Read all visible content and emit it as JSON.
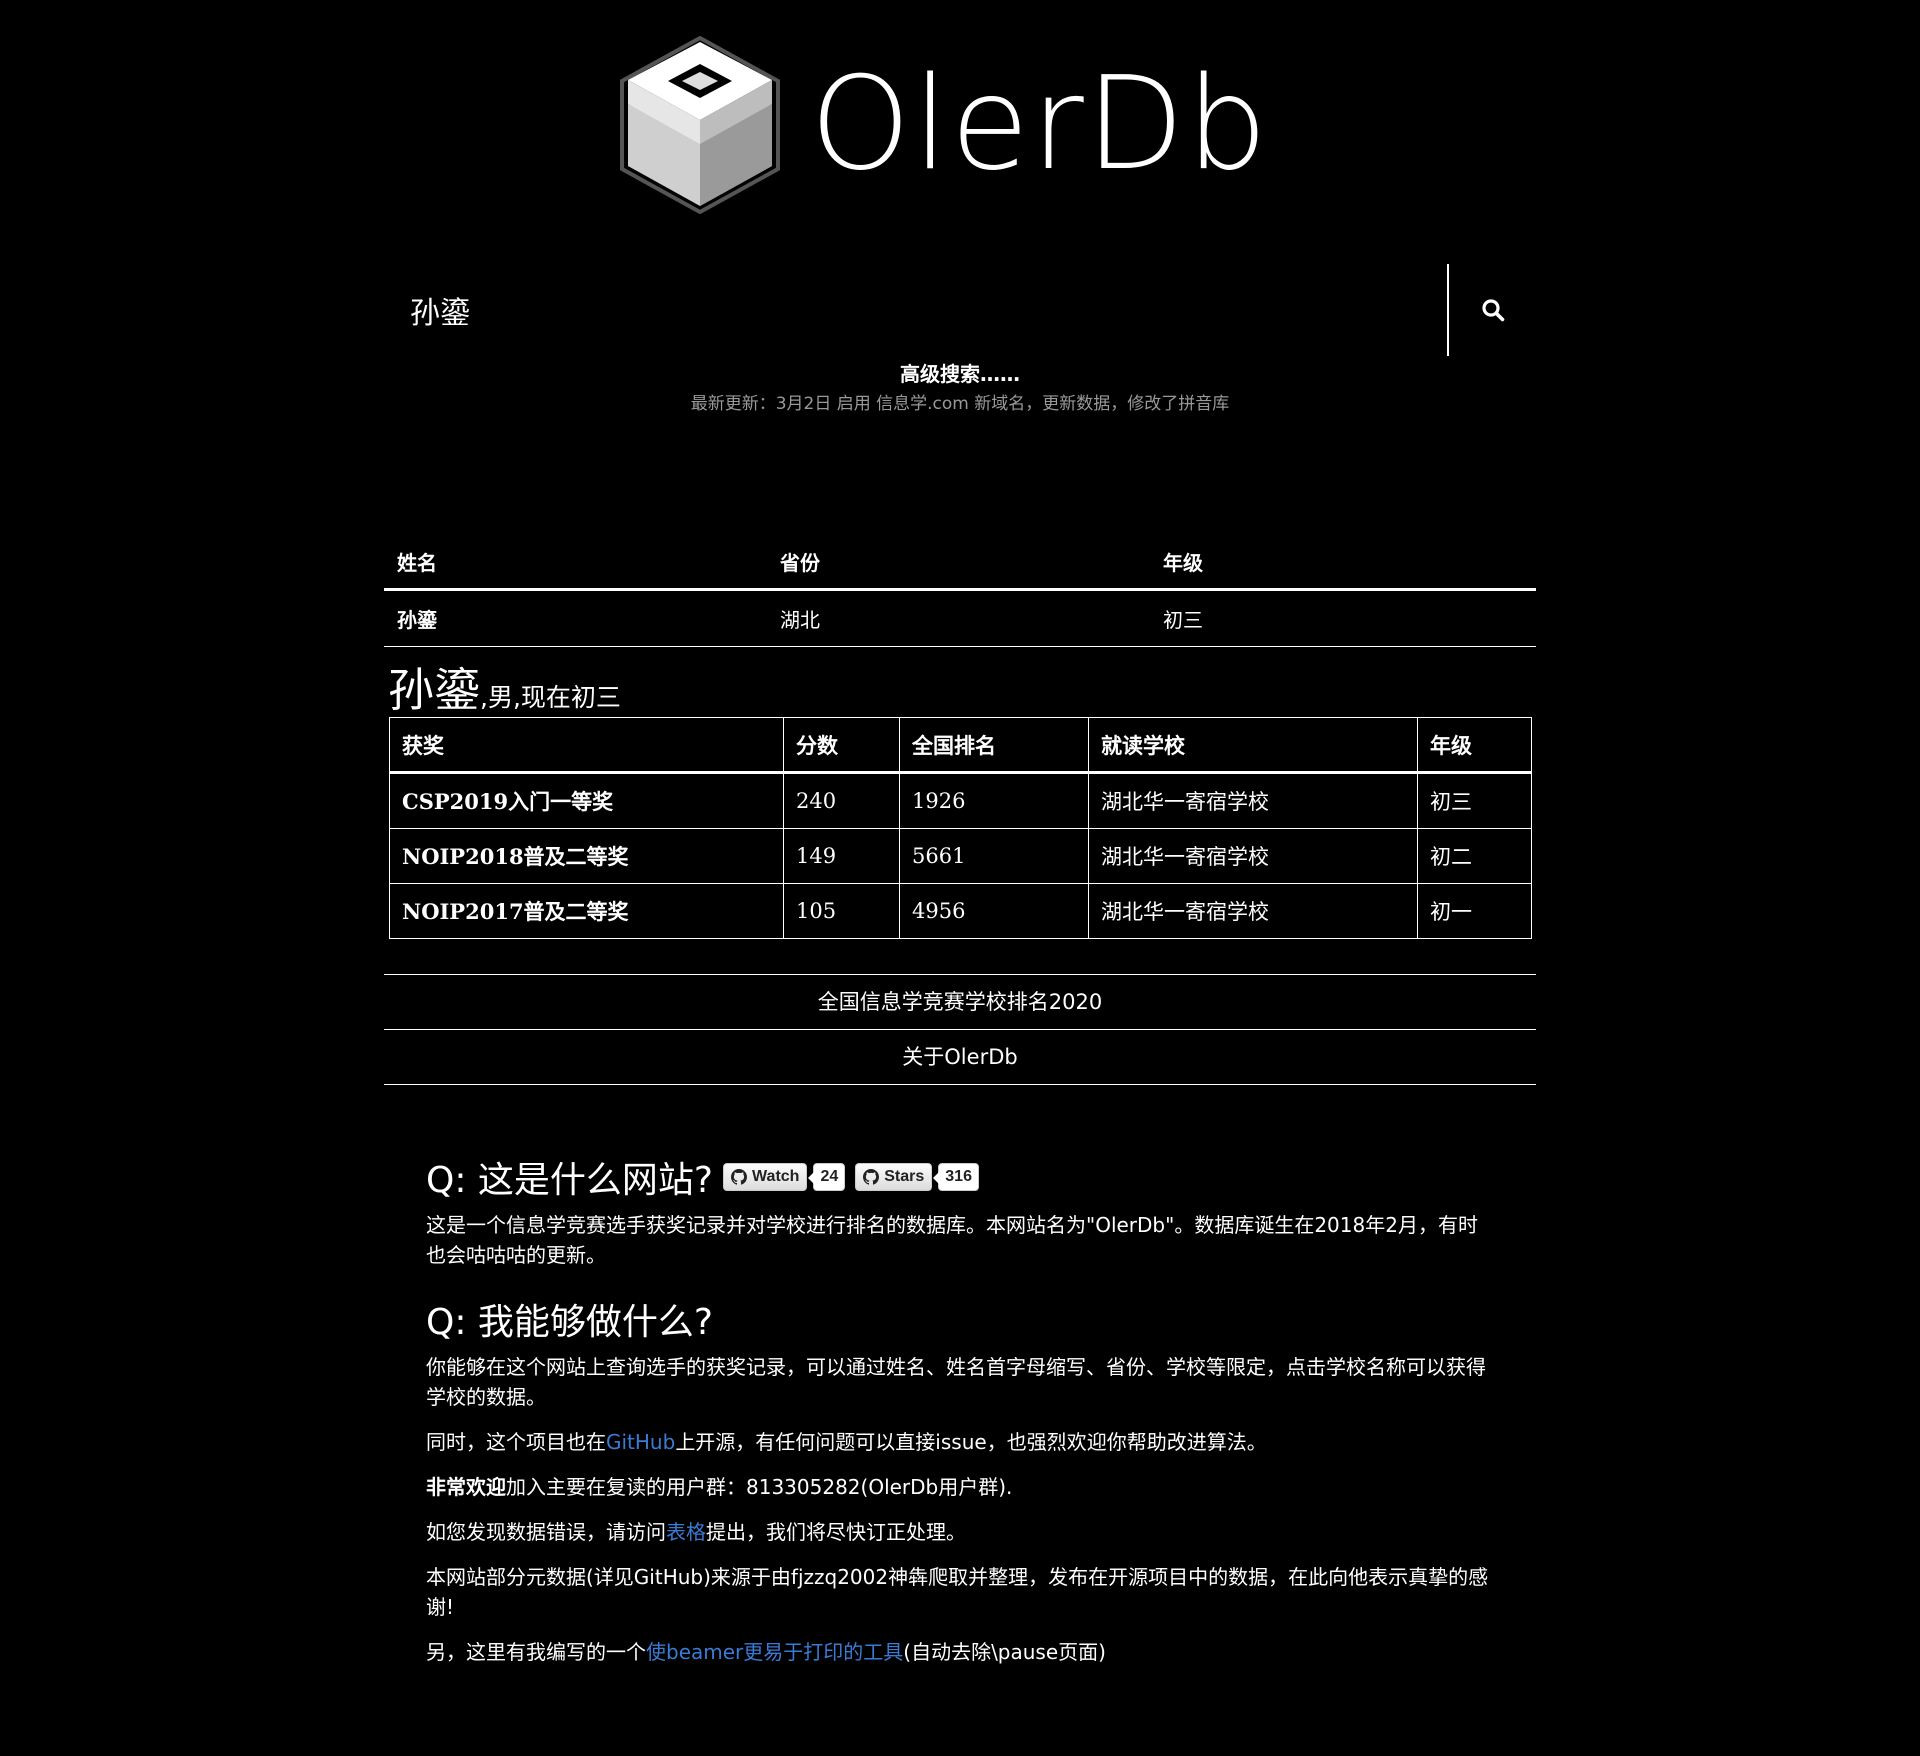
{
  "brand": {
    "logo_text": "OlerDb",
    "logo_icon": "stacked-cube-logo-icon"
  },
  "search": {
    "value": "孙鎏",
    "icon": "search-icon"
  },
  "advanced_search": "高级搜索……",
  "update_note": "最新更新：3月2日 启用 信息学.com 新域名，更新数据，修改了拼音库",
  "result_table": {
    "headers": [
      "姓名",
      "省份",
      "年级"
    ],
    "rows": [
      [
        "孙鎏",
        "湖北",
        "初三"
      ]
    ]
  },
  "detail": {
    "name": "孙鎏",
    "subtitle": ",男,现在初三",
    "headers": [
      "获奖",
      "分数",
      "全国排名",
      "就读学校",
      "年级"
    ],
    "rows": [
      [
        "CSP2019入门一等奖",
        "240",
        "1926",
        "湖北华一寄宿学校",
        "初三"
      ],
      [
        "NOIP2018普及二等奖",
        "149",
        "5661",
        "湖北华一寄宿学校",
        "初二"
      ],
      [
        "NOIP2017普及二等奖",
        "105",
        "4956",
        "湖北华一寄宿学校",
        "初一"
      ]
    ]
  },
  "nav": {
    "school_rank": "全国信息学竞赛学校排名2020",
    "about": "关于OlerDb"
  },
  "about": {
    "q1": "Q: 这是什么网站?",
    "badges": {
      "watch_label": "Watch",
      "watch_count": "24",
      "stars_label": "Stars",
      "stars_count": "316"
    },
    "a1": "这是一个信息学竞赛选手获奖记录并对学校进行排名的数据库。本网站名为\"OlerDb\"。数据库诞生在2018年2月，有时也会咕咕咕的更新。",
    "q2": "Q: 我能够做什么?",
    "a2": "你能够在这个网站上查询选手的获奖记录，可以通过姓名、姓名首字母缩写、省份、学校等限定，点击学校名称可以获得学校的数据。",
    "p3_before": "同时，这个项目也在",
    "p3_link": "GitHub",
    "p3_after": "上开源，有任何问题可以直接issue，也强烈欢迎你帮助改进算法。",
    "p4_bold": "非常欢迎",
    "p4_rest": "加入主要在复读的用户群：813305282(OlerDb用户群).",
    "p5_before": "如您发现数据错误，请访问",
    "p5_link": "表格",
    "p5_after": "提出，我们将尽快订正处理。",
    "p6": "本网站部分元数据(详见GitHub)来源于由fjzzq2002神犇爬取并整理，发布在开源项目中的数据，在此向他表示真挚的感谢!",
    "p7_before": "另，这里有我编写的一个",
    "p7_link": "使beamer更易于打印的工具",
    "p7_after": "(自动去除\\pause页面)"
  },
  "colors": {
    "background": "#000000",
    "text": "#ffffff",
    "link": "#3a7bd5",
    "muted": "#999999"
  }
}
